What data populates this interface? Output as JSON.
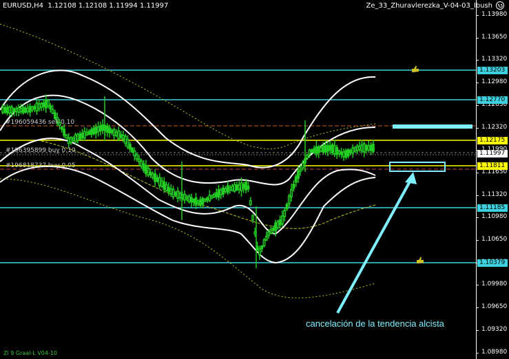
{
  "header": {
    "symbol_info": "EURUSD,H4  1.12108 1.12108 1.11994 1.11997",
    "expert_name": "Ze_33_Zhuravlerezka_V-04-03_Ibush"
  },
  "price_axis": {
    "ticks": [
      "1.13980",
      "1.13650",
      "1.13320",
      "1.12980",
      "1.12650",
      "1.12320",
      "1.11990",
      "1.11650",
      "1.11320",
      "1.10980",
      "1.10650",
      "1.10320",
      "1.09980",
      "1.09650",
      "1.09320",
      "1.08980"
    ]
  },
  "price_labels": {
    "level_1": "1.13203",
    "level_2": "1.12770",
    "level_3": "1.12175",
    "level_4": "1.11997",
    "level_5": "1.11811",
    "level_6": "1.11185",
    "level_7": "1.10379"
  },
  "orders": {
    "order_1": "#196059436 sell 0.10",
    "order_2": "#196395899 buy 0.10",
    "order_3": "#196818737 buy 0.05"
  },
  "annotation": "cancelación de la tendencia alcista",
  "footer": "Zi 9 Graal-L V04-10",
  "colors": {
    "background": "#000000",
    "cyan_level": "#3fd0e0",
    "yellow_level": "#ffff00",
    "candle": "#22cc22",
    "band": "#ffffff",
    "annotation": "#7ff0ff"
  },
  "icons": [
    "thumbs-up-icon",
    "smiley-icon",
    "arrow-icon"
  ]
}
